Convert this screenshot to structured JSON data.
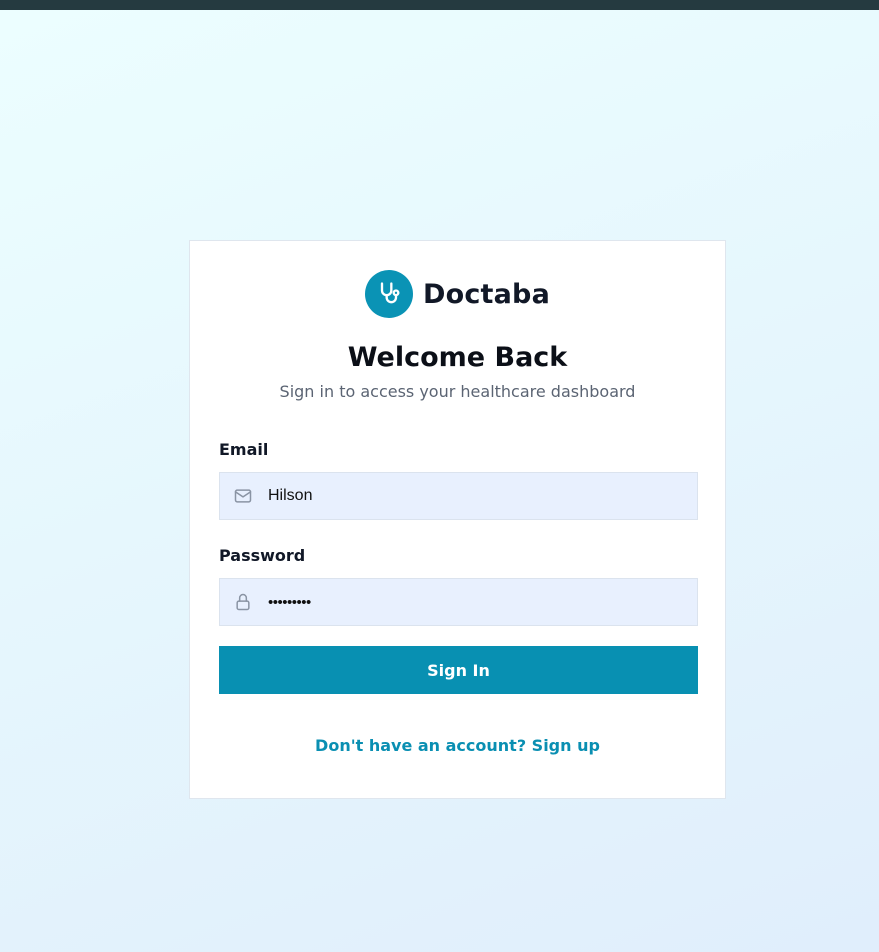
{
  "brand": {
    "name": "Doctaba",
    "icon": "stethoscope-icon"
  },
  "login": {
    "title": "Welcome Back",
    "subtitle": "Sign in to access your healthcare dashboard",
    "email": {
      "label": "Email",
      "value": "Hilson",
      "icon": "mail-icon"
    },
    "password": {
      "label": "Password",
      "value": "•••••••••",
      "icon": "lock-icon"
    },
    "submit_label": "Sign In",
    "signup_link": "Don't have an account? Sign up"
  },
  "colors": {
    "primary": "#0890b2",
    "input_bg": "#e8f0fe",
    "top_bar": "#253a40"
  }
}
